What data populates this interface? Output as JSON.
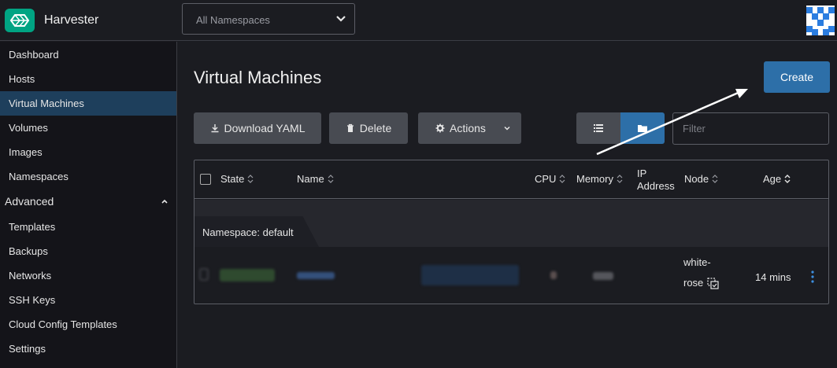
{
  "header": {
    "app_title": "Harvester",
    "namespace_select": {
      "value": "All Namespaces"
    },
    "logo_icon": "harvester-logo",
    "avatar_icon": "user-avatar"
  },
  "sidebar": {
    "items": [
      {
        "label": "Dashboard",
        "active": false
      },
      {
        "label": "Hosts",
        "active": false
      },
      {
        "label": "Virtual Machines",
        "active": true
      },
      {
        "label": "Volumes",
        "active": false
      },
      {
        "label": "Images",
        "active": false
      },
      {
        "label": "Namespaces",
        "active": false
      }
    ],
    "group": {
      "label": "Advanced",
      "expanded": true
    },
    "group_items": [
      {
        "label": "Templates"
      },
      {
        "label": "Backups"
      },
      {
        "label": "Networks"
      },
      {
        "label": "SSH Keys"
      },
      {
        "label": "Cloud Config Templates"
      },
      {
        "label": "Settings"
      }
    ]
  },
  "main": {
    "title": "Virtual Machines",
    "create_label": "Create",
    "toolbar": {
      "download_label": "Download YAML",
      "delete_label": "Delete",
      "actions_label": "Actions"
    },
    "filter_placeholder": "Filter",
    "table": {
      "columns": {
        "state": "State",
        "name": "Name",
        "cpu": "CPU",
        "memory": "Memory",
        "ip_line1": "IP",
        "ip_line2": "Address",
        "node": "Node",
        "age": "Age"
      },
      "group_label": "Namespace: default",
      "rows": [
        {
          "node_line1": "white-",
          "node_line2": "rose",
          "age": "14 mins"
        }
      ]
    }
  },
  "colors": {
    "accent": "#2d6fa8",
    "brand": "#00a483",
    "active_nav": "#1e3f5c",
    "background": "#1b1c21"
  }
}
